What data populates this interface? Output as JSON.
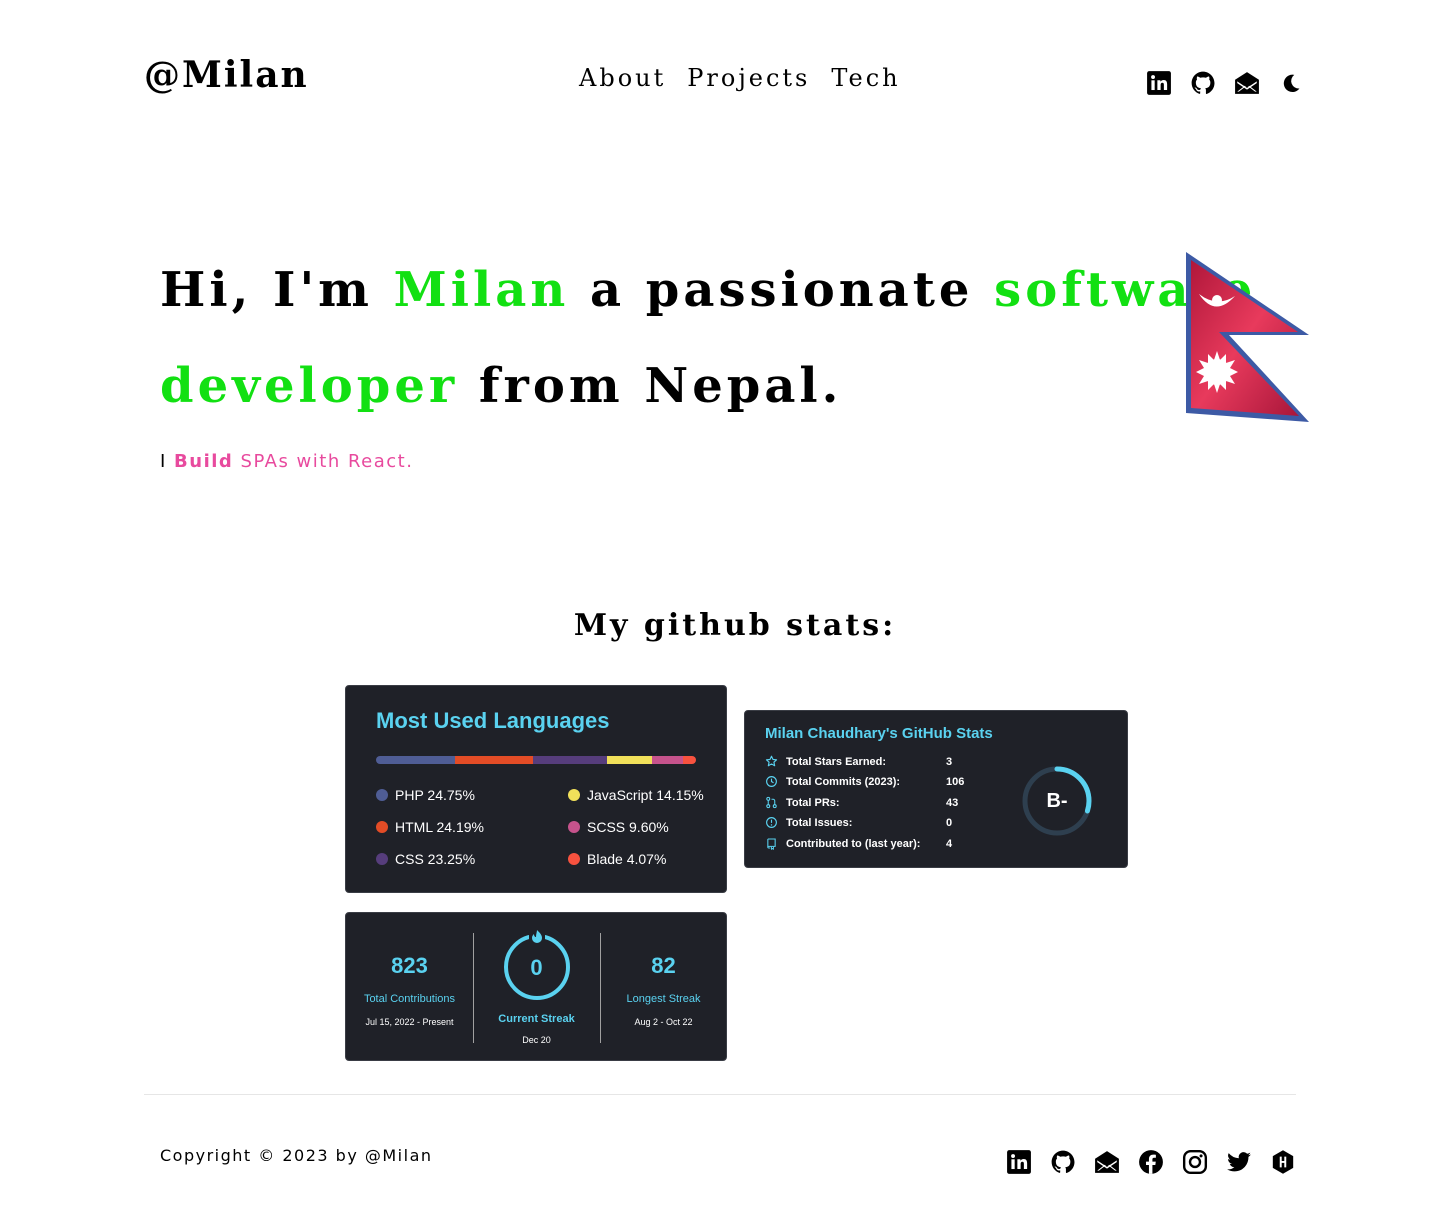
{
  "header": {
    "logo": "@Milan",
    "nav": [
      "About",
      "Projects",
      "Tech"
    ],
    "icons": [
      "linkedin-icon",
      "github-icon",
      "mail-icon",
      "moon-icon"
    ]
  },
  "hero": {
    "line1_a": "Hi, I'm ",
    "line1_b": "Milan",
    "line1_c": " a passionate ",
    "line1_d": "software",
    "line2_a": "developer",
    "line2_b": " from Nepal.",
    "tag_prefix": "I ",
    "tag_word": "Build",
    "tag_rest": " SPAs with React.",
    "accent": "#12e012",
    "tag_color": "#e84a9e"
  },
  "stats": {
    "title": "My github stats:",
    "languages": {
      "title": "Most Used Languages",
      "items": [
        {
          "name": "PHP 24.75%",
          "color": "#4f5d95",
          "pct": 24.75
        },
        {
          "name": "HTML 24.19%",
          "color": "#e34c26",
          "pct": 24.19
        },
        {
          "name": "CSS 23.25%",
          "color": "#563d7c",
          "pct": 23.25
        },
        {
          "name": "JavaScript 14.15%",
          "color": "#f1e05a",
          "pct": 14.15
        },
        {
          "name": "SCSS 9.60%",
          "color": "#c6538c",
          "pct": 9.6
        },
        {
          "name": "Blade 4.07%",
          "color": "#f7523f",
          "pct": 4.07
        }
      ]
    },
    "github": {
      "title": "Milan Chaudhary's GitHub Stats",
      "rows": [
        {
          "label": "Total Stars Earned:",
          "value": "3",
          "icon": "star-icon"
        },
        {
          "label": "Total Commits (2023):",
          "value": "106",
          "icon": "history-icon"
        },
        {
          "label": "Total PRs:",
          "value": "43",
          "icon": "pull-request-icon"
        },
        {
          "label": "Total Issues:",
          "value": "0",
          "icon": "issue-icon"
        },
        {
          "label": "Contributed to (last year):",
          "value": "4",
          "icon": "repo-icon"
        }
      ],
      "grade": "B-",
      "grade_progress": 0.3
    },
    "streak": {
      "total": "823",
      "total_label": "Total Contributions",
      "total_range": "Jul 15, 2022 - Present",
      "current": "0",
      "current_label": "Current Streak",
      "current_date": "Dec 20",
      "longest": "82",
      "longest_label": "Longest Streak",
      "longest_range": "Aug 2 - Oct 22"
    }
  },
  "footer": {
    "copyright": "Copyright © 2023 by @Milan",
    "icons": [
      "linkedin-icon",
      "github-icon",
      "mail-icon",
      "facebook-icon",
      "instagram-icon",
      "twitter-icon",
      "hashnode-icon"
    ]
  }
}
